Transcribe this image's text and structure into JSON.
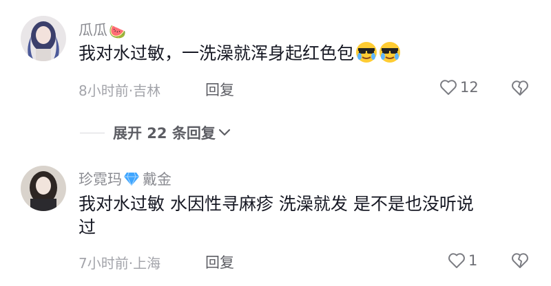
{
  "comments": [
    {
      "username": "瓜瓜",
      "username_emoji": "🍉",
      "text": "我对水过敏，一洗澡就浑身起红色包",
      "time_location": "8小时前·吉林",
      "reply_label": "回复",
      "likes": "12"
    },
    {
      "username": "珍霓玛",
      "badge": "diamond-icon",
      "badge_label": "戴金",
      "text_line1": "我对水过敏 水因性寻麻疹 洗澡就发 是不是也没听说",
      "text_line2": "过",
      "time_location": "7小时前·上海",
      "reply_label": "回复",
      "likes": "1"
    }
  ],
  "expand_replies": "展开 22 条回复",
  "colors": {
    "text": "#161823",
    "meta": "#a3a4aa",
    "username": "#8a8b91",
    "badge": "#4aa8ff"
  }
}
